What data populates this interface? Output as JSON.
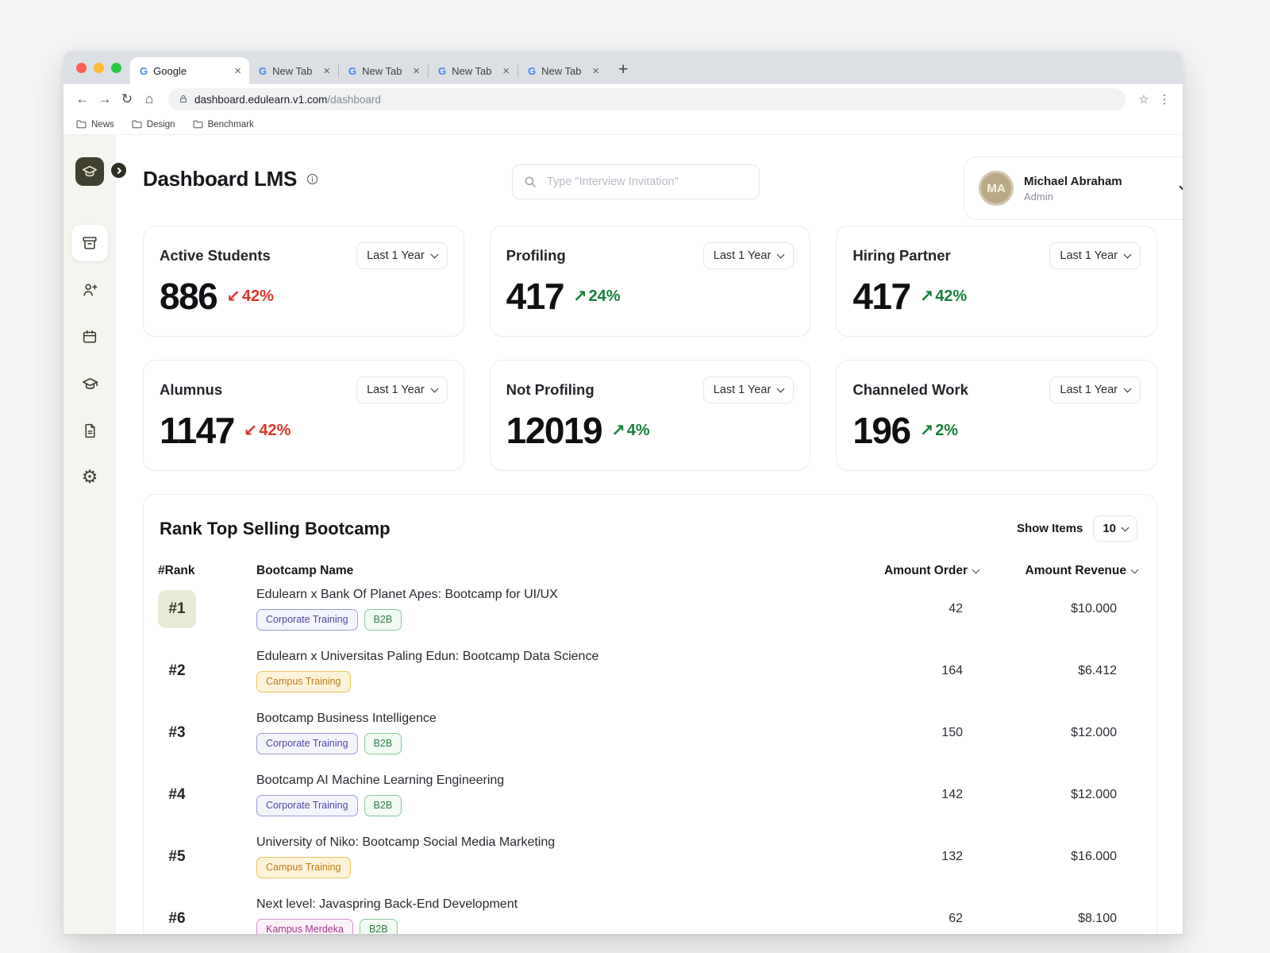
{
  "colors": {
    "accent_dark": "#3f4030",
    "sidebar_bg": "#f5f4ee",
    "trend_down": "#d8372b",
    "trend_up": "#17803c",
    "rank_highlight_bg": "#e9ead6",
    "avatar_bg": "#b9aa84",
    "tag_corporate_text": "#4f46a5",
    "tag_b2b_text": "#2e7d44",
    "tag_campus_text": "#c07b17",
    "tag_merdeka_text": "#a0388f"
  },
  "browser": {
    "tabs": [
      {
        "label": "Google"
      },
      {
        "label": "New Tab"
      },
      {
        "label": "New Tab"
      },
      {
        "label": "New Tab"
      },
      {
        "label": "New Tab"
      }
    ],
    "favicon_glyph": "G",
    "close_glyph": "×",
    "new_tab_glyph": "+",
    "back_glyph": "←",
    "forward_glyph": "→",
    "reload_glyph": "↻",
    "home_glyph": "⌂",
    "star_glyph": "☆",
    "menu_glyph": "⋮",
    "url_host": "dashboard.edulearn.v1.com",
    "url_path": "/dashboard",
    "bookmarks": [
      {
        "label": "News"
      },
      {
        "label": "Design"
      },
      {
        "label": "Benchmark"
      }
    ]
  },
  "header": {
    "title": "Dashboard LMS",
    "search_placeholder": "Type \"Interview Invitation\"",
    "user": {
      "initials": "MA",
      "name": "Michael Abraham",
      "role": "Admin"
    }
  },
  "stats": {
    "period_label": "Last 1 Year",
    "cards": [
      {
        "title": "Active Students",
        "value": "886",
        "arrow": "↙",
        "trend": "42%",
        "direction": "down"
      },
      {
        "title": "Profiling",
        "value": "417",
        "arrow": "↗",
        "trend": "24%",
        "direction": "up"
      },
      {
        "title": "Hiring Partner",
        "value": "417",
        "arrow": "↗",
        "trend": "42%",
        "direction": "up"
      },
      {
        "title": "Alumnus",
        "value": "1147",
        "arrow": "↙",
        "trend": "42%",
        "direction": "down"
      },
      {
        "title": "Not Profiling",
        "value": "12019",
        "arrow": "↗",
        "trend": "4%",
        "direction": "up"
      },
      {
        "title": "Channeled Work",
        "value": "196",
        "arrow": "↗",
        "trend": "2%",
        "direction": "up"
      }
    ]
  },
  "table": {
    "title": "Rank Top Selling Bootcamp",
    "show_items_label": "Show Items",
    "show_items_value": "10",
    "headers": {
      "rank": "#Rank",
      "name": "Bootcamp Name",
      "order": "Amount Order",
      "revenue": "Amount Revenue"
    },
    "rows": [
      {
        "rank": "#1",
        "name": "Edulearn x Bank Of Planet Apes: Bootcamp for UI/UX",
        "tags": [
          {
            "label": "Corporate Training"
          },
          {
            "label": "B2B"
          }
        ],
        "order": "42",
        "revenue": "$10.000"
      },
      {
        "rank": "#2",
        "name": "Edulearn x Universitas Paling Edun: Bootcamp Data Science",
        "tags": [
          {
            "label": "Campus Training"
          }
        ],
        "order": "164",
        "revenue": "$6.412"
      },
      {
        "rank": "#3",
        "name": "Bootcamp Business Intelligence",
        "tags": [
          {
            "label": "Corporate Training"
          },
          {
            "label": "B2B"
          }
        ],
        "order": "150",
        "revenue": "$12.000"
      },
      {
        "rank": "#4",
        "name": "Bootcamp AI Machine Learning Engineering",
        "tags": [
          {
            "label": "Corporate Training"
          },
          {
            "label": "B2B"
          }
        ],
        "order": "142",
        "revenue": "$12.000"
      },
      {
        "rank": "#5",
        "name": "University of Niko: Bootcamp Social Media Marketing",
        "tags": [
          {
            "label": "Campus Training"
          }
        ],
        "order": "132",
        "revenue": "$16.000"
      },
      {
        "rank": "#6",
        "name": "Next level: Javaspring Back-End Development",
        "tags": [
          {
            "label": "Kampus Merdeka"
          },
          {
            "label": "B2B"
          }
        ],
        "order": "62",
        "revenue": "$8.100"
      }
    ]
  },
  "icons": {
    "gear_glyph": "⚙"
  }
}
